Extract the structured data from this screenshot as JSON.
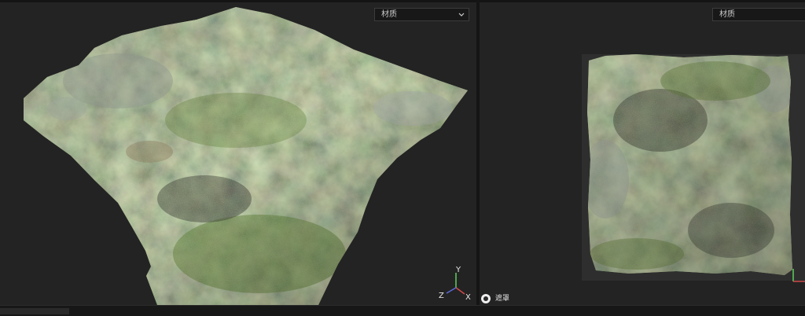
{
  "left_viewport": {
    "material_dropdown": {
      "value": "材质"
    },
    "axis_gizmo": {
      "y": "Y",
      "z": "Z",
      "x": "X"
    }
  },
  "right_viewport": {
    "material_dropdown": {
      "value": "材质"
    },
    "legend": {
      "label": "遮罩",
      "icon": "mask-radio-icon"
    }
  },
  "colors": {
    "background": "#1d1d1d",
    "viewport": "#232323",
    "moss": "#5b7a2a",
    "rock": "#6f7570",
    "dirt": "#7a6440"
  }
}
